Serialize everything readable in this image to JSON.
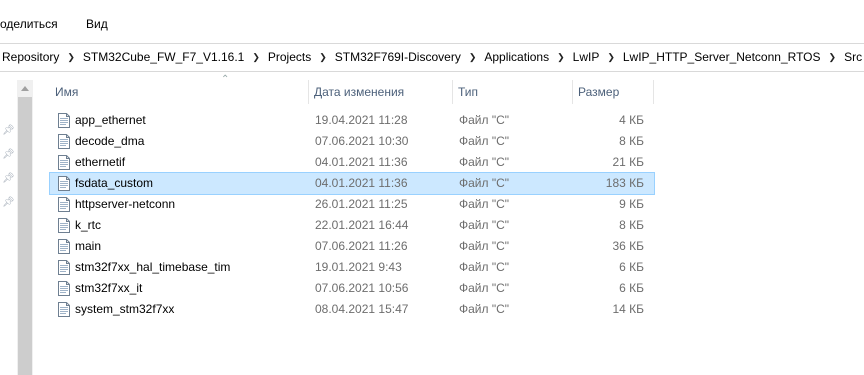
{
  "menu": [
    "оделиться",
    "Вид"
  ],
  "breadcrumb": [
    "Repository",
    "STM32Cube_FW_F7_V1.16.1",
    "Projects",
    "STM32F769I-Discovery",
    "Applications",
    "LwIP",
    "LwIP_HTTP_Server_Netconn_RTOS",
    "Src"
  ],
  "columns": {
    "name": "Имя",
    "date": "Дата изменения",
    "type": "Тип",
    "size": "Размер"
  },
  "files": [
    {
      "name": "app_ethernet",
      "date": "19.04.2021 11:28",
      "type": "Файл \"C\"",
      "size": "4 КБ"
    },
    {
      "name": "decode_dma",
      "date": "07.06.2021 10:30",
      "type": "Файл \"C\"",
      "size": "8 КБ"
    },
    {
      "name": "ethernetif",
      "date": "04.01.2021 11:36",
      "type": "Файл \"C\"",
      "size": "21 КБ"
    },
    {
      "name": "fsdata_custom",
      "date": "04.01.2021 11:36",
      "type": "Файл \"C\"",
      "size": "183 КБ",
      "selected": true
    },
    {
      "name": "httpserver-netconn",
      "date": "26.01.2021 11:25",
      "type": "Файл \"C\"",
      "size": "9 КБ"
    },
    {
      "name": "k_rtc",
      "date": "22.01.2021 16:44",
      "type": "Файл \"C\"",
      "size": "8 КБ"
    },
    {
      "name": "main",
      "date": "07.06.2021 11:26",
      "type": "Файл \"C\"",
      "size": "36 КБ"
    },
    {
      "name": "stm32f7xx_hal_timebase_tim",
      "date": "19.01.2021 9:43",
      "type": "Файл \"C\"",
      "size": "6 КБ"
    },
    {
      "name": "stm32f7xx_it",
      "date": "07.06.2021 10:56",
      "type": "Файл \"C\"",
      "size": "6 КБ"
    },
    {
      "name": "system_stm32f7xx",
      "date": "08.04.2021 15:47",
      "type": "Файл \"C\"",
      "size": "14 КБ"
    }
  ],
  "colors": {
    "selection": "#cce8ff",
    "selection_border": "#99d1ff",
    "header_text": "#4c607a"
  },
  "icons": {
    "file": "c-source-file-icon",
    "pin": "pin-icon",
    "sort": "sort-up-icon"
  }
}
